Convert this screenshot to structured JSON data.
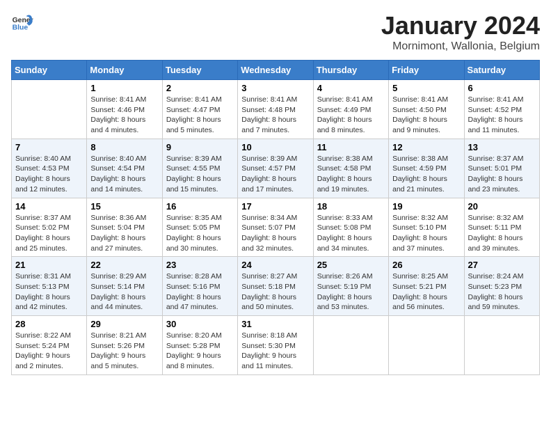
{
  "logo": {
    "general": "General",
    "blue": "Blue"
  },
  "title": "January 2024",
  "location": "Mornimont, Wallonia, Belgium",
  "days_of_week": [
    "Sunday",
    "Monday",
    "Tuesday",
    "Wednesday",
    "Thursday",
    "Friday",
    "Saturday"
  ],
  "weeks": [
    [
      {
        "day": "",
        "info": ""
      },
      {
        "day": "1",
        "info": "Sunrise: 8:41 AM\nSunset: 4:46 PM\nDaylight: 8 hours\nand 4 minutes."
      },
      {
        "day": "2",
        "info": "Sunrise: 8:41 AM\nSunset: 4:47 PM\nDaylight: 8 hours\nand 5 minutes."
      },
      {
        "day": "3",
        "info": "Sunrise: 8:41 AM\nSunset: 4:48 PM\nDaylight: 8 hours\nand 7 minutes."
      },
      {
        "day": "4",
        "info": "Sunrise: 8:41 AM\nSunset: 4:49 PM\nDaylight: 8 hours\nand 8 minutes."
      },
      {
        "day": "5",
        "info": "Sunrise: 8:41 AM\nSunset: 4:50 PM\nDaylight: 8 hours\nand 9 minutes."
      },
      {
        "day": "6",
        "info": "Sunrise: 8:41 AM\nSunset: 4:52 PM\nDaylight: 8 hours\nand 11 minutes."
      }
    ],
    [
      {
        "day": "7",
        "info": "Sunrise: 8:40 AM\nSunset: 4:53 PM\nDaylight: 8 hours\nand 12 minutes."
      },
      {
        "day": "8",
        "info": "Sunrise: 8:40 AM\nSunset: 4:54 PM\nDaylight: 8 hours\nand 14 minutes."
      },
      {
        "day": "9",
        "info": "Sunrise: 8:39 AM\nSunset: 4:55 PM\nDaylight: 8 hours\nand 15 minutes."
      },
      {
        "day": "10",
        "info": "Sunrise: 8:39 AM\nSunset: 4:57 PM\nDaylight: 8 hours\nand 17 minutes."
      },
      {
        "day": "11",
        "info": "Sunrise: 8:38 AM\nSunset: 4:58 PM\nDaylight: 8 hours\nand 19 minutes."
      },
      {
        "day": "12",
        "info": "Sunrise: 8:38 AM\nSunset: 4:59 PM\nDaylight: 8 hours\nand 21 minutes."
      },
      {
        "day": "13",
        "info": "Sunrise: 8:37 AM\nSunset: 5:01 PM\nDaylight: 8 hours\nand 23 minutes."
      }
    ],
    [
      {
        "day": "14",
        "info": "Sunrise: 8:37 AM\nSunset: 5:02 PM\nDaylight: 8 hours\nand 25 minutes."
      },
      {
        "day": "15",
        "info": "Sunrise: 8:36 AM\nSunset: 5:04 PM\nDaylight: 8 hours\nand 27 minutes."
      },
      {
        "day": "16",
        "info": "Sunrise: 8:35 AM\nSunset: 5:05 PM\nDaylight: 8 hours\nand 30 minutes."
      },
      {
        "day": "17",
        "info": "Sunrise: 8:34 AM\nSunset: 5:07 PM\nDaylight: 8 hours\nand 32 minutes."
      },
      {
        "day": "18",
        "info": "Sunrise: 8:33 AM\nSunset: 5:08 PM\nDaylight: 8 hours\nand 34 minutes."
      },
      {
        "day": "19",
        "info": "Sunrise: 8:32 AM\nSunset: 5:10 PM\nDaylight: 8 hours\nand 37 minutes."
      },
      {
        "day": "20",
        "info": "Sunrise: 8:32 AM\nSunset: 5:11 PM\nDaylight: 8 hours\nand 39 minutes."
      }
    ],
    [
      {
        "day": "21",
        "info": "Sunrise: 8:31 AM\nSunset: 5:13 PM\nDaylight: 8 hours\nand 42 minutes."
      },
      {
        "day": "22",
        "info": "Sunrise: 8:29 AM\nSunset: 5:14 PM\nDaylight: 8 hours\nand 44 minutes."
      },
      {
        "day": "23",
        "info": "Sunrise: 8:28 AM\nSunset: 5:16 PM\nDaylight: 8 hours\nand 47 minutes."
      },
      {
        "day": "24",
        "info": "Sunrise: 8:27 AM\nSunset: 5:18 PM\nDaylight: 8 hours\nand 50 minutes."
      },
      {
        "day": "25",
        "info": "Sunrise: 8:26 AM\nSunset: 5:19 PM\nDaylight: 8 hours\nand 53 minutes."
      },
      {
        "day": "26",
        "info": "Sunrise: 8:25 AM\nSunset: 5:21 PM\nDaylight: 8 hours\nand 56 minutes."
      },
      {
        "day": "27",
        "info": "Sunrise: 8:24 AM\nSunset: 5:23 PM\nDaylight: 8 hours\nand 59 minutes."
      }
    ],
    [
      {
        "day": "28",
        "info": "Sunrise: 8:22 AM\nSunset: 5:24 PM\nDaylight: 9 hours\nand 2 minutes."
      },
      {
        "day": "29",
        "info": "Sunrise: 8:21 AM\nSunset: 5:26 PM\nDaylight: 9 hours\nand 5 minutes."
      },
      {
        "day": "30",
        "info": "Sunrise: 8:20 AM\nSunset: 5:28 PM\nDaylight: 9 hours\nand 8 minutes."
      },
      {
        "day": "31",
        "info": "Sunrise: 8:18 AM\nSunset: 5:30 PM\nDaylight: 9 hours\nand 11 minutes."
      },
      {
        "day": "",
        "info": ""
      },
      {
        "day": "",
        "info": ""
      },
      {
        "day": "",
        "info": ""
      }
    ]
  ]
}
